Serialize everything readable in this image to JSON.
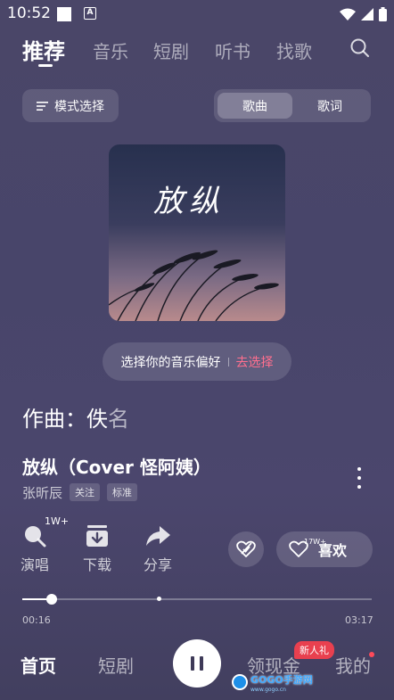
{
  "status_bar": {
    "time": "10:52",
    "a_badge": "A"
  },
  "top_nav": {
    "tabs": [
      {
        "label": "推荐",
        "active": true
      },
      {
        "label": "音乐"
      },
      {
        "label": "短剧"
      },
      {
        "label": "听书"
      },
      {
        "label": "找歌"
      }
    ],
    "search_icon": "search-icon"
  },
  "mode_select": {
    "label": "模式选择",
    "icon": "list-icon"
  },
  "segment": {
    "left": "歌曲",
    "right": "歌词",
    "selected": "歌曲"
  },
  "album_cover": {
    "title_text": "放纵"
  },
  "preference": {
    "text": "选择你的音乐偏好",
    "link": "去选择"
  },
  "composer": {
    "prefix": "作曲：佚",
    "suffix": "名"
  },
  "song": {
    "title": "放纵（Cover 怪阿姨）",
    "artist": "张昕辰",
    "tag_follow": "关注",
    "tag_quality": "标准"
  },
  "actions": {
    "sing": {
      "label": "演唱",
      "count": "1W+"
    },
    "download": {
      "label": "下载"
    },
    "share": {
      "label": "分享"
    },
    "like": {
      "label": "喜欢",
      "count": "17W+"
    }
  },
  "progress": {
    "current": "00:16",
    "total": "03:17",
    "fraction": 0.085
  },
  "bottom_nav": {
    "home": "首页",
    "drama": "短剧",
    "cash": "领现金",
    "cash_badge": "新人礼",
    "mine": "我的"
  },
  "watermark": {
    "brand": "GOGO手游网",
    "url": "www.gogo.cn"
  },
  "colors": {
    "accent_pink": "#ff6f8e",
    "badge_red": "#e8404f"
  }
}
